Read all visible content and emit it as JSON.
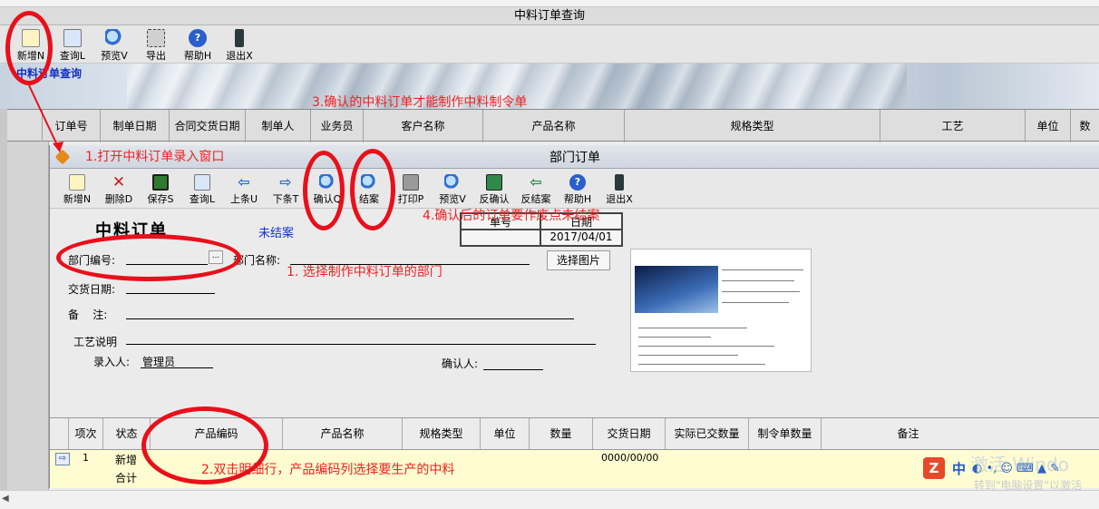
{
  "outer": {
    "title": "中料订单查询",
    "subtitle": "中料订单查询",
    "toolbar": [
      {
        "label": "新增N",
        "icon": "new-doc-icon",
        "color": "#fbf3c2"
      },
      {
        "label": "查询L",
        "icon": "query-doc-icon",
        "color": "#d8e6f8"
      },
      {
        "label": "预览V",
        "icon": "magnifier-icon",
        "color": "#3a7bd5"
      },
      {
        "label": "导出",
        "icon": "export-icon",
        "color": "#5a5a5a"
      },
      {
        "label": "帮助H",
        "icon": "help-icon",
        "color": "#2b5fc9"
      },
      {
        "label": "退出X",
        "icon": "exit-icon",
        "color": "#2a3a3a"
      }
    ],
    "grid_columns": [
      "订单号",
      "制单日期",
      "合同交货日期",
      "制单人",
      "业务员",
      "客户名称",
      "产品名称",
      "规格类型",
      "工艺",
      "单位",
      "数"
    ]
  },
  "inner": {
    "title": "部门订单",
    "toolbar": [
      {
        "label": "新增N",
        "icon": "new-doc-icon",
        "color": "#fbf3c2"
      },
      {
        "label": "删除D",
        "icon": "delete-x-icon",
        "color": "#cc1a1a"
      },
      {
        "label": "保存S",
        "icon": "save-disk-icon",
        "color": "#2f7a2f"
      },
      {
        "label": "查询L",
        "icon": "query-doc-icon",
        "color": "#d8e6f8"
      },
      {
        "label": "上条U",
        "icon": "arrow-left-icon",
        "color": "#2d6ad1"
      },
      {
        "label": "下条T",
        "icon": "arrow-right-icon",
        "color": "#2d6ad1"
      },
      {
        "label": "确认Q",
        "icon": "confirm-magnifier-icon",
        "color": "#3a7bd5"
      },
      {
        "label": "结案",
        "icon": "close-case-magnifier-icon",
        "color": "#3a7bd5"
      },
      {
        "label": "打印P",
        "icon": "printer-icon",
        "color": "#6a6a6a"
      },
      {
        "label": "预览V",
        "icon": "preview-magnifier-icon",
        "color": "#3a7bd5"
      },
      {
        "label": "反确认",
        "icon": "unconfirm-icon",
        "color": "#2f8a4a"
      },
      {
        "label": "反结案",
        "icon": "unclose-icon",
        "color": "#2f8a4a"
      },
      {
        "label": "帮助H",
        "icon": "help-icon",
        "color": "#2b5fc9"
      },
      {
        "label": "退出X",
        "icon": "exit-icon",
        "color": "#2a3a3a"
      }
    ],
    "form": {
      "doc_title": "中料订单",
      "status": "未结案",
      "order_no_label": "单号",
      "date_label": "日期",
      "date_value": "2017/04/01",
      "dept_no_label": "部门编号:",
      "dept_browse": "...",
      "dept_name_label": "部门名称:",
      "select_pic_button": "选择图片",
      "delivery_date_label": "交货日期:",
      "remark_label": "备    注:",
      "process_label": "工艺说明",
      "entered_by_label": "录入人:",
      "entered_by_value": "管理员",
      "confirmed_by_label": "确认人:"
    },
    "detail": {
      "columns": [
        "项次",
        "状态",
        "产品编码",
        "产品名称",
        "规格类型",
        "单位",
        "数量",
        "交货日期",
        "实际已交数量",
        "制令单数量",
        "备注"
      ],
      "rows": [
        {
          "seq": "1",
          "status": "新增",
          "date": "0000/00/00"
        }
      ],
      "total_label": "合计"
    }
  },
  "annotations": {
    "step1_open": "1.打开中料订单录入窗口",
    "step1_dept": "1. 选择制作中料订单的部门",
    "step2": "2.双击明细行，产品编码列选择要生产的中料",
    "step3": "3.确认的中料订单才能制作中料制令单",
    "step4": "4.确认后的订单要作废点未结案"
  },
  "taskbar": {
    "ime_logo": "Z",
    "ime_lang": "中",
    "watermark": "激活 Windo",
    "watermark_sub": "转到\"电脑设置\"以激活"
  },
  "colors": {
    "annotation_red": "#e8101a",
    "status_blue": "#1030d0",
    "detail_row_yellow": "#fefcd0"
  }
}
